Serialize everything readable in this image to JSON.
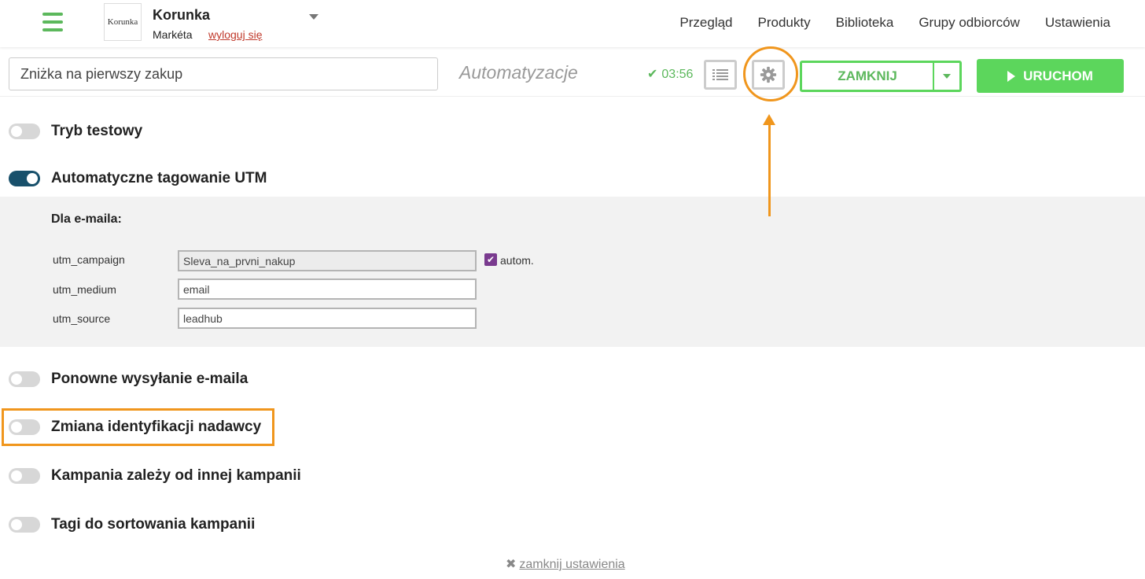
{
  "header": {
    "logo_text": "Korunka",
    "company_name": "Korunka",
    "user_name": "Markéta",
    "logout_label": "wyloguj się",
    "nav": [
      "Przegląd",
      "Produkty",
      "Biblioteka",
      "Grupy odbiorców",
      "Ustawienia"
    ]
  },
  "toolbar": {
    "campaign_name": "Zniżka na pierwszy zakup",
    "section_label": "Automatyzacje",
    "saved_time": "03:56",
    "close_label": "ZAMKNIJ",
    "run_label": "URUCHOM"
  },
  "settings": {
    "test_mode": {
      "label": "Tryb testowy",
      "on": false
    },
    "utm_tagging": {
      "label": "Automatyczne tagowanie UTM",
      "on": true
    },
    "resend_email": {
      "label": "Ponowne wysyłanie e-maila",
      "on": false
    },
    "sender_change": {
      "label": "Zmiana identyfikacji nadawcy",
      "on": false
    },
    "depends_on_campaign": {
      "label": "Kampania zależy od innej kampanii",
      "on": false
    },
    "sorting_tags": {
      "label": "Tagi do sortowania kampanii",
      "on": false
    }
  },
  "utm": {
    "heading": "Dla e-maila:",
    "campaign_label": "utm_campaign",
    "campaign_value": "Sleva_na_prvni_nakup",
    "auto_label": "autom.",
    "auto_checked": true,
    "medium_label": "utm_medium",
    "medium_value": "email",
    "source_label": "utm_source",
    "source_value": "leadhub"
  },
  "footer": {
    "close_settings_label": "zamknij ustawienia"
  },
  "colors": {
    "accent_green": "#5cd65c",
    "toggle_on": "#18506b",
    "highlight_orange": "#f0961d",
    "logout_red": "#c0392b",
    "checkbox_purple": "#7a3b8f"
  },
  "icons": [
    "hamburger-icon",
    "caret-down-icon",
    "check-icon",
    "list-icon",
    "gear-icon",
    "play-icon",
    "close-x-icon"
  ]
}
